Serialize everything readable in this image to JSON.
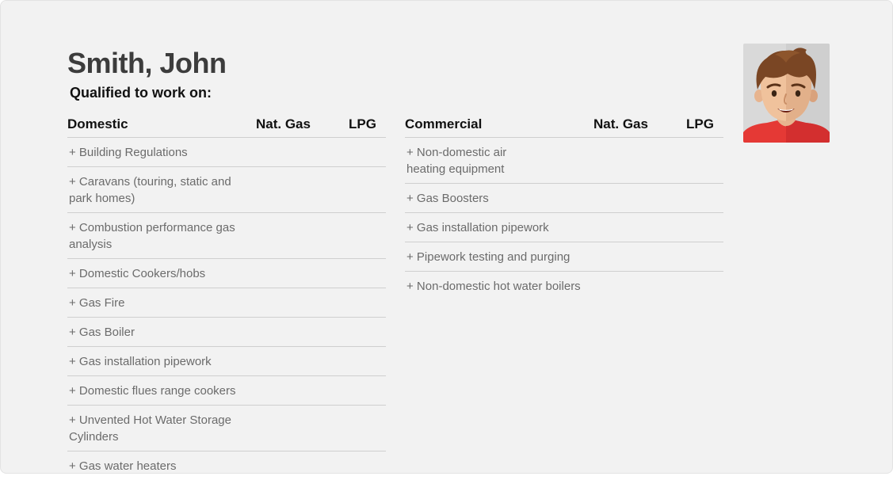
{
  "profile": {
    "name": "Smith, John",
    "subtitle": "Qualified to work on:"
  },
  "domestic": {
    "header": {
      "category": "Domestic",
      "nat_gas": "Nat. Gas",
      "lpg": "LPG"
    },
    "items": [
      "+ Building Regulations",
      "+ Caravans (touring, static and park homes)",
      "+ Combustion performance gas analysis",
      "+ Domestic Cookers/hobs",
      "+ Gas Fire",
      "+ Gas Boiler",
      "+ Gas installation pipework",
      "+ Domestic flues range cookers",
      "+ Unvented Hot Water Storage Cylinders",
      "+ Gas water heaters"
    ]
  },
  "commercial": {
    "header": {
      "category": "Commercial",
      "nat_gas": "Nat. Gas",
      "lpg": "LPG"
    },
    "items": [
      "+ Non-domestic air heating equipment",
      "+ Gas Boosters",
      "+ Gas installation pipework",
      "+ Pipework testing and purging",
      "+ Non-domestic hot water boilers"
    ]
  },
  "colors": {
    "background": "#f2f2f2",
    "name_text": "#3c3c3c",
    "item_text": "#6b6b6b",
    "divider": "#cfcfcf",
    "avatar_shirt": "#e53935"
  },
  "icons": {
    "avatar": "avatar-icon"
  }
}
